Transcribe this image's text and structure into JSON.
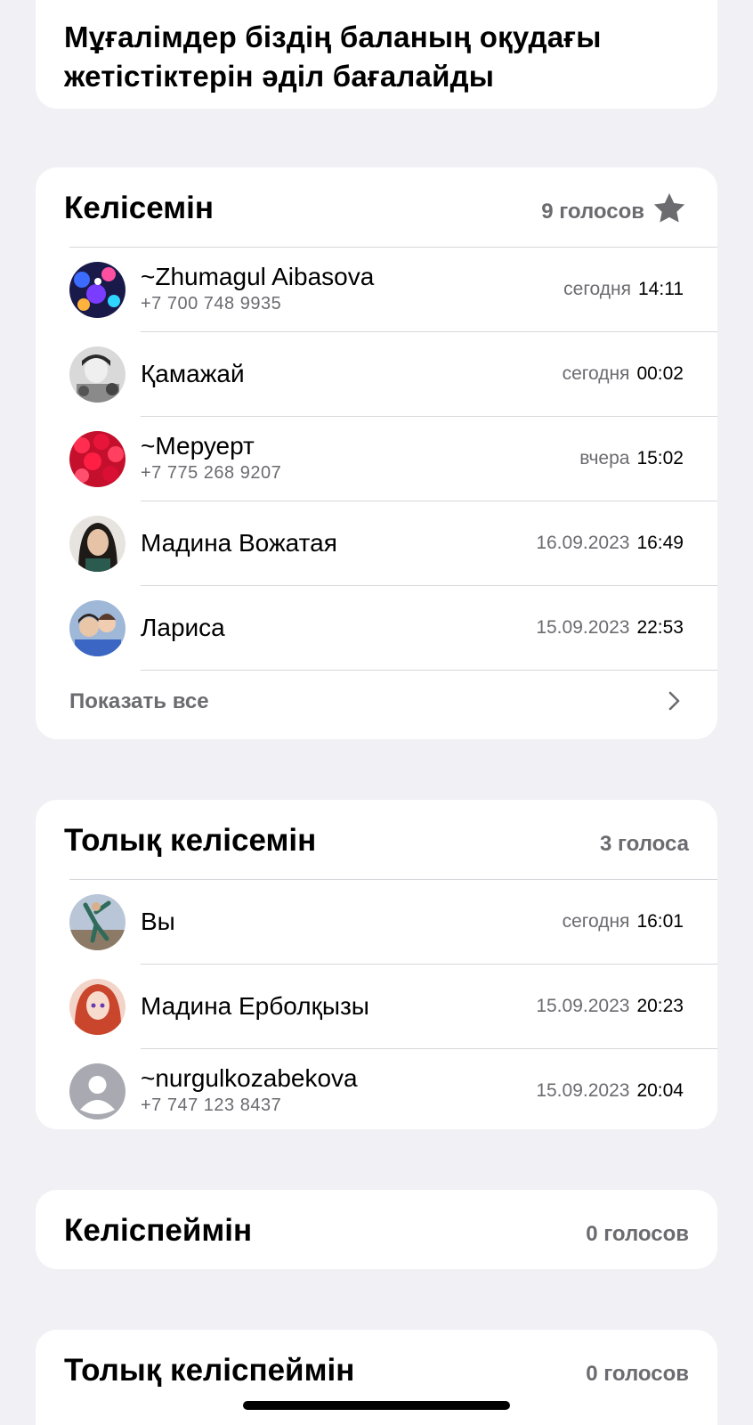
{
  "question": "Мұғалімдер біздің баланың оқудағы жетістіктерін әділ бағалайды",
  "options": [
    {
      "title": "Келісемін",
      "count": "9 голосов",
      "starred": true,
      "voters": [
        {
          "name": "~Zhumagul Aibasova",
          "phone": "+7 700 748 9935",
          "date": "сегодня",
          "time": "14:11",
          "avatar": "avatar-colorful-abstract"
        },
        {
          "name": "Қамажай",
          "phone": "",
          "date": "сегодня",
          "time": "00:02",
          "avatar": "avatar-bw-photo"
        },
        {
          "name": "~Меруерт",
          "phone": "+7 775 268 9207",
          "date": "вчера",
          "time": "15:02",
          "avatar": "avatar-roses"
        },
        {
          "name": "Мадина Вожатая",
          "phone": "",
          "date": "16.09.2023",
          "time": "16:49",
          "avatar": "avatar-woman-portrait"
        },
        {
          "name": "Лариса",
          "phone": "",
          "date": "15.09.2023",
          "time": "22:53",
          "avatar": "avatar-children"
        }
      ],
      "show_all": "Показать все"
    },
    {
      "title": "Толық келісемін",
      "count": "3 голоса",
      "starred": false,
      "voters": [
        {
          "name": "Вы",
          "phone": "",
          "date": "сегодня",
          "time": "16:01",
          "avatar": "avatar-sport"
        },
        {
          "name": "Мадина Ерболқызы",
          "phone": "",
          "date": "15.09.2023",
          "time": "20:23",
          "avatar": "avatar-anime-girl"
        },
        {
          "name": "~nurgulkozabekova",
          "phone": "+7 747 123 8437",
          "date": "15.09.2023",
          "time": "20:04",
          "avatar": "avatar-placeholder"
        }
      ]
    },
    {
      "title": "Келіспеймін",
      "count": "0 голосов",
      "starred": false,
      "voters": []
    },
    {
      "title": "Толық келіспеймін",
      "count": "0 голосов",
      "starred": false,
      "voters": []
    }
  ]
}
